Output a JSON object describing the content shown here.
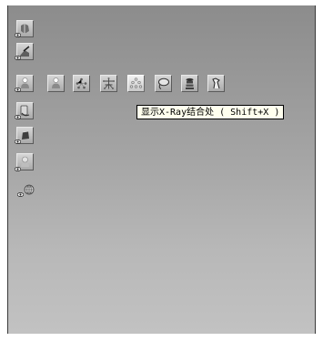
{
  "tooltip": {
    "text": "显示X-Ray结合处 ( Shift+X )"
  },
  "toolbar": {
    "left_column_icons": [
      "mesh-display-icon",
      "edit-mesh-icon",
      "joint-display-icon",
      "brush-icon",
      "shading-icon",
      "skin-display-icon",
      "grid-sphere-icon"
    ],
    "flyout_icons": [
      "joint-icon",
      "joint-stars-icon",
      "x-ray-joints-icon",
      "x-ray-joint-cluster-icon",
      "lasso-icon",
      "stack-icon",
      "pin-icon"
    ],
    "active_flyout": "x-ray-joint-cluster-icon"
  }
}
